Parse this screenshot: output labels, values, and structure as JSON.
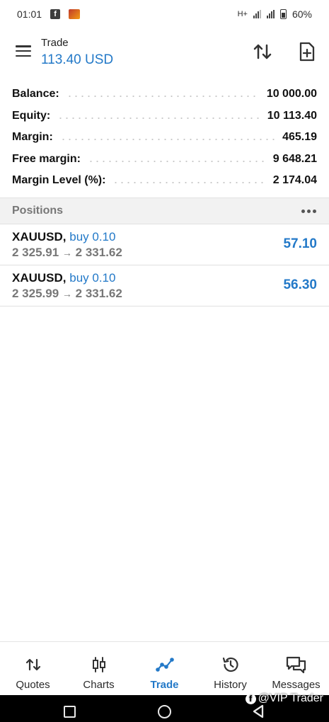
{
  "status_bar": {
    "time": "01:01",
    "network": "H+",
    "battery": "60%"
  },
  "header": {
    "title": "Trade",
    "balance": "113.40 USD"
  },
  "summary": [
    {
      "label": "Balance:",
      "value": "10 000.00"
    },
    {
      "label": "Equity:",
      "value": "10 113.40"
    },
    {
      "label": "Margin:",
      "value": "465.19"
    },
    {
      "label": "Free margin:",
      "value": "9 648.21"
    },
    {
      "label": "Margin Level (%):",
      "value": "2 174.04"
    }
  ],
  "positions": {
    "title": "Positions",
    "items": [
      {
        "symbol": "XAUUSD,",
        "type": "buy 0.10",
        "open_price": "2 325.91",
        "arrow": "→",
        "current_price": "2 331.62",
        "profit": "57.10"
      },
      {
        "symbol": "XAUUSD,",
        "type": "buy 0.10",
        "open_price": "2 325.99",
        "arrow": "→",
        "current_price": "2 331.62",
        "profit": "56.30"
      }
    ]
  },
  "nav": {
    "items": [
      {
        "label": "Quotes",
        "icon": "quotes-icon"
      },
      {
        "label": "Charts",
        "icon": "charts-icon"
      },
      {
        "label": "Trade",
        "icon": "trade-icon",
        "active": true
      },
      {
        "label": "History",
        "icon": "history-icon"
      },
      {
        "label": "Messages",
        "icon": "messages-icon"
      }
    ]
  },
  "watermark": "@VIP Trader",
  "colors": {
    "accent": "#2379c8",
    "text": "#111111",
    "muted": "#777777"
  }
}
